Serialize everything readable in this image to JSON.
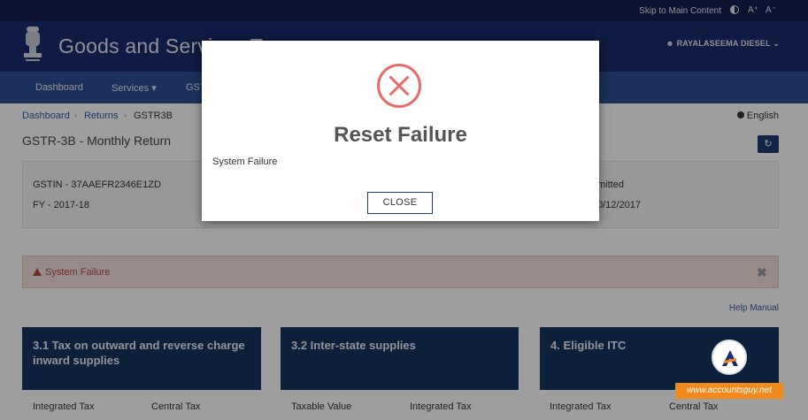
{
  "topbar": {
    "skip_link": "Skip to Main Content",
    "font_increase": "A⁺",
    "font_decrease": "A⁻"
  },
  "header": {
    "title": "Goods and Services Tax",
    "user_name": "RAYALASEEMA DIESEL",
    "colors": {
      "top_strip": "#131f4e",
      "header": "#1b2c6c",
      "nav": "#2c4f94"
    }
  },
  "nav": {
    "items": [
      {
        "label": "Dashboard"
      },
      {
        "label": "Services ▾"
      },
      {
        "label": "GST"
      }
    ]
  },
  "breadcrumb": {
    "items": [
      "Dashboard",
      "Returns",
      "GSTR3B"
    ]
  },
  "language": "English",
  "page_title": "GSTR-3B - Monthly Return",
  "info": {
    "gstin": "GSTIN - 37AAEFR2346E1ZD",
    "fy": "FY - 2017-18",
    "status_fragment": "mitted",
    "date_fragment": "0/12/2017"
  },
  "alert": {
    "message": "System Failure",
    "close": "✖"
  },
  "help_link": "Help Manual",
  "tiles": [
    {
      "title": "3.1 Tax on outward and reverse charge inward supplies",
      "col1": "Integrated Tax",
      "col2": "Central Tax"
    },
    {
      "title": "3.2 Inter-state supplies",
      "col1": "Taxable Value",
      "col2": "Integrated Tax"
    },
    {
      "title": "4. Eligible ITC",
      "col1": "Integrated Tax",
      "col2": "Central Tax"
    }
  ],
  "watermark": {
    "url": "www.accountsguy.net"
  },
  "modal": {
    "title": "Reset Failure",
    "message": "System Failure",
    "close_button": "CLOSE",
    "icon_color": "#e66b6b"
  }
}
